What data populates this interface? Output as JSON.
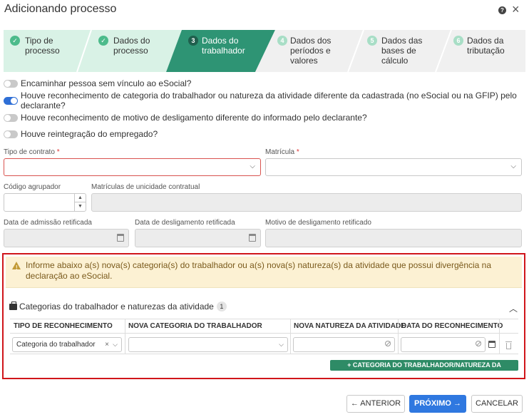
{
  "window": {
    "title": "Adicionando processo"
  },
  "stepper": {
    "steps": [
      {
        "num": "",
        "label": "Tipo de processo",
        "state": "done"
      },
      {
        "num": "",
        "label": "Dados do processo",
        "state": "done"
      },
      {
        "num": "3",
        "label": "Dados do trabalhador",
        "state": "active"
      },
      {
        "num": "4",
        "label": "Dados dos períodos e valores",
        "state": "pending"
      },
      {
        "num": "5",
        "label": "Dados das bases de cálculo",
        "state": "pending"
      },
      {
        "num": "6",
        "label": "Dados da tributação",
        "state": "pending"
      }
    ]
  },
  "toggles": [
    {
      "label": "Encaminhar pessoa sem vínculo ao eSocial?",
      "on": false
    },
    {
      "label": "Houve reconhecimento de categoria do trabalhador ou natureza da atividade diferente da cadastrada (no eSocial ou na GFIP) pelo declarante?",
      "on": true
    },
    {
      "label": "Houve reconhecimento de motivo de desligamento diferente do informado pelo declarante?",
      "on": false
    },
    {
      "label": "Houve reintegração do empregado?",
      "on": false
    }
  ],
  "fields": {
    "tipo_contrato": {
      "label": "Tipo de contrato",
      "required": "*"
    },
    "matricula": {
      "label": "Matrícula",
      "required": "*"
    },
    "codigo_agrupador": {
      "label": "Código agrupador"
    },
    "matriculas_unicidade": {
      "label": "Matrículas de unicidade contratual"
    },
    "data_admissao": {
      "label": "Data de admissão retificada"
    },
    "data_desligamento": {
      "label": "Data de desligamento retificada"
    },
    "motivo_desligamento": {
      "label": "Motivo de desligamento retificado"
    }
  },
  "panel": {
    "warning": "Informe abaixo a(s) nova(s) categoria(s) do trabalhador ou a(s) nova(s) natureza(s) da atividade que possui divergência na declaração ao eSocial.",
    "section_title": "Categorias do trabalhador e naturezas da atividade",
    "count": "1",
    "columns": [
      "TIPO DE RECONHECIMENTO",
      "NOVA CATEGORIA DO TRABALHADOR",
      "NOVA NATUREZA DA ATIVIDADE",
      "DATA DO RECONHECIMENTO"
    ],
    "row": {
      "tipo": "Categoria do trabalhador"
    },
    "add_button": "+ CATEGORIA DO TRABALHADOR/NATUREZA DA ATIVIDADE"
  },
  "footer": {
    "previous": "← ANTERIOR",
    "next": "PRÓXIMO →",
    "cancel": "CANCELAR"
  },
  "colors": {
    "done": "#d9f2e6",
    "active": "#2e9474",
    "pending": "#f0f0f0",
    "primary": "#2f78e0",
    "error": "#d0151a"
  }
}
